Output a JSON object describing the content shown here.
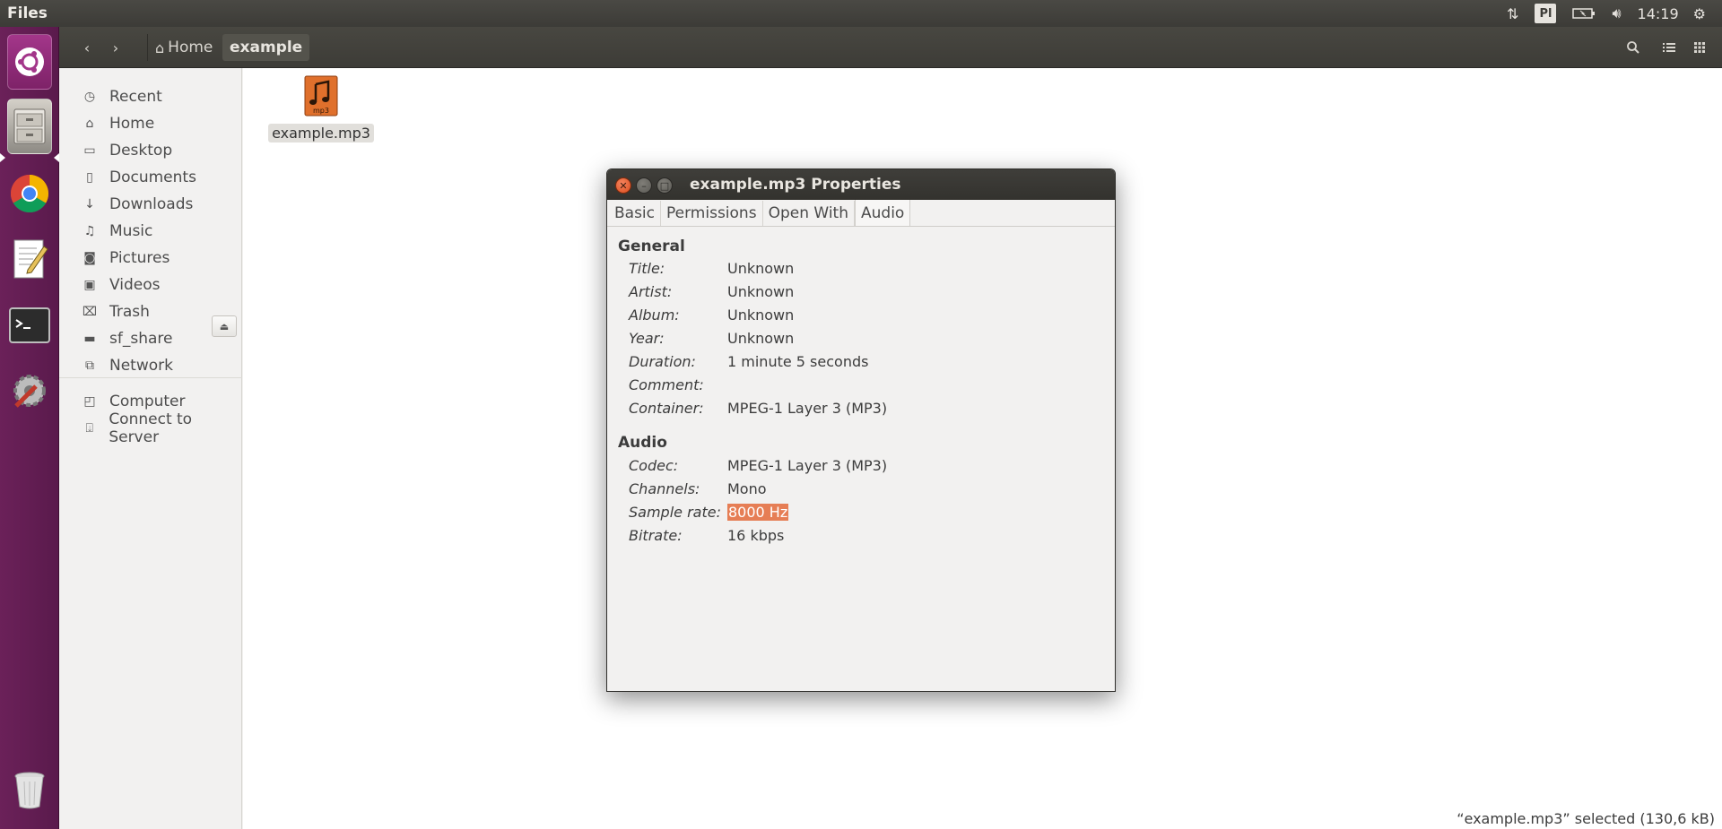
{
  "top_panel": {
    "app_title": "Files",
    "keyboard_layout": "Pl",
    "clock": "14:19"
  },
  "launcher": {
    "items": [
      "dash-home",
      "files",
      "chrome",
      "text-editor",
      "terminal",
      "system-settings",
      "trash"
    ]
  },
  "headerbar": {
    "breadcrumbs": [
      "Home",
      "example"
    ]
  },
  "sidebar": {
    "items": [
      {
        "label": "Recent",
        "icon": "clock-icon"
      },
      {
        "label": "Home",
        "icon": "home-icon"
      },
      {
        "label": "Desktop",
        "icon": "folder-icon"
      },
      {
        "label": "Documents",
        "icon": "document-icon"
      },
      {
        "label": "Downloads",
        "icon": "download-icon"
      },
      {
        "label": "Music",
        "icon": "music-icon"
      },
      {
        "label": "Pictures",
        "icon": "camera-icon"
      },
      {
        "label": "Videos",
        "icon": "video-icon"
      },
      {
        "label": "Trash",
        "icon": "trash-icon"
      },
      {
        "label": "sf_share",
        "icon": "drive-icon"
      },
      {
        "label": "Network",
        "icon": "network-icon"
      },
      {
        "label": "Computer",
        "icon": "computer-icon"
      },
      {
        "label": "Connect to Server",
        "icon": "server-icon"
      }
    ]
  },
  "main": {
    "file": {
      "name": "example.mp3",
      "icon_badge": "mp3"
    },
    "status": "“example.mp3” selected (130,6 kB)"
  },
  "dialog": {
    "title": "example.mp3 Properties",
    "tabs": [
      "Basic",
      "Permissions",
      "Open With",
      "Audio"
    ],
    "active_tab": "Audio",
    "general": {
      "heading": "General",
      "rows": [
        {
          "label": "Title:",
          "value": "Unknown"
        },
        {
          "label": "Artist:",
          "value": "Unknown"
        },
        {
          "label": "Album:",
          "value": "Unknown"
        },
        {
          "label": "Year:",
          "value": "Unknown"
        },
        {
          "label": "Duration:",
          "value": "1 minute 5 seconds"
        },
        {
          "label": "Comment:",
          "value": ""
        },
        {
          "label": "Container:",
          "value": "MPEG-1 Layer 3 (MP3)"
        }
      ]
    },
    "audio": {
      "heading": "Audio",
      "rows": [
        {
          "label": "Codec:",
          "value": "MPEG-1 Layer 3 (MP3)"
        },
        {
          "label": "Channels:",
          "value": "Mono"
        },
        {
          "label": "Sample rate:",
          "value": "8000 Hz"
        },
        {
          "label": "Bitrate:",
          "value": "16 kbps"
        }
      ]
    }
  },
  "colors": {
    "launcher_bg": "#5d1a4e",
    "accent_orange": "#e67e55",
    "panel_bg": "#3c3b37"
  }
}
